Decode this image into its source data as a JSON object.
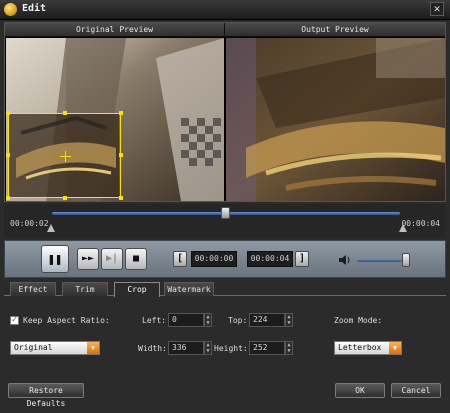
{
  "window": {
    "title": "Edit"
  },
  "preview": {
    "original_label": "Original Preview",
    "output_label": "Output Preview"
  },
  "timeline": {
    "start_time": "00:00:02",
    "end_time": "00:00:04",
    "position": 0.5
  },
  "controls": {
    "play_pause_icon": "pause-icon",
    "trim_start_time": "00:00:00",
    "trim_end_time": "00:00:04",
    "start_bracket": "[",
    "end_bracket": "]",
    "volume_level": 0.95
  },
  "tabs": [
    {
      "label": "Effect",
      "active": false
    },
    {
      "label": "Trim",
      "active": false
    },
    {
      "label": "Crop",
      "active": true
    },
    {
      "label": "Watermark",
      "active": false
    }
  ],
  "crop": {
    "keep_aspect_label": "Keep Aspect Ratio:",
    "keep_aspect_checked": true,
    "aspect_value": "Original",
    "left_label": "Left:",
    "left_value": "0",
    "top_label": "Top:",
    "top_value": "224",
    "width_label": "Width:",
    "width_value": "336",
    "height_label": "Height:",
    "height_value": "252",
    "zoom_mode_label": "Zoom Mode:",
    "zoom_mode_value": "Letterbox"
  },
  "buttons": {
    "restore": "Restore Defaults",
    "ok": "OK",
    "cancel": "Cancel"
  },
  "colors": {
    "crop_frame": "#ffe100",
    "accent_orange": "#e07000",
    "slider_blue": "#2f4f86"
  }
}
